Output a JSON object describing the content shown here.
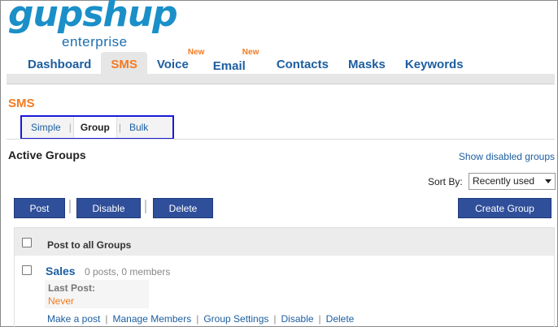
{
  "brand": {
    "logo_main": "gupshup",
    "logo_sub": "enterprise"
  },
  "nav": {
    "items": [
      {
        "label": "Dashboard",
        "badge": ""
      },
      {
        "label": "SMS",
        "badge": ""
      },
      {
        "label": "Voice",
        "badge": "New"
      },
      {
        "label": "Email",
        "badge": "New"
      },
      {
        "label": "Contacts",
        "badge": ""
      },
      {
        "label": "Masks",
        "badge": ""
      },
      {
        "label": "Keywords",
        "badge": ""
      }
    ],
    "active": "SMS"
  },
  "page": {
    "title": "SMS"
  },
  "subtabs": {
    "items": [
      "Simple",
      "Group",
      "Bulk"
    ],
    "active": "Group"
  },
  "groups": {
    "section_title": "Active Groups",
    "show_disabled_link": "Show disabled groups",
    "sort_label": "Sort By:",
    "sort_value": "Recently used",
    "toolbar": {
      "post": "Post",
      "disable": "Disable",
      "delete": "Delete",
      "create": "Create Group"
    },
    "header_label": "Post to all Groups",
    "rows": [
      {
        "name": "Sales",
        "meta": "0 posts, 0 members",
        "last_post_label": "Last Post:",
        "last_post_value": "Never",
        "actions": [
          "Make a post",
          "Manage Members",
          "Group Settings",
          "Disable",
          "Delete"
        ]
      }
    ]
  },
  "colors": {
    "accent_orange": "#f47a20",
    "link_blue": "#1c5ea0",
    "button_blue": "#2f4f9a",
    "highlight_border": "#1a1ad8"
  }
}
